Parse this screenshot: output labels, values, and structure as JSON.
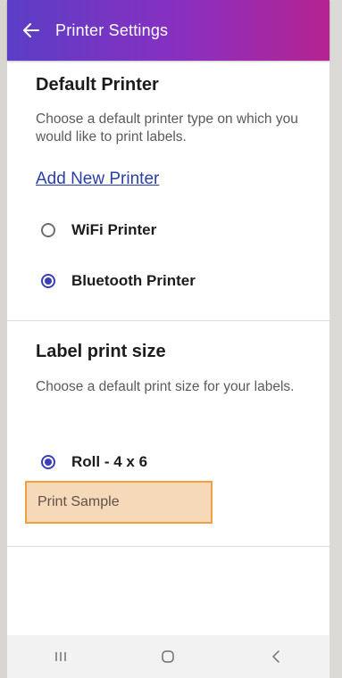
{
  "appbar": {
    "title": "Printer Settings",
    "back_icon": "arrow-left-icon",
    "gradient": [
      "#5b3ec6",
      "#8a2fc0",
      "#b5238f"
    ]
  },
  "default_printer": {
    "title": "Default Printer",
    "description": "Choose a default printer type on which you would like to print labels.",
    "add_link": "Add New Printer",
    "options": [
      {
        "label": "WiFi Printer",
        "selected": false
      },
      {
        "label": "Bluetooth Printer",
        "selected": true
      }
    ]
  },
  "label_size": {
    "title": "Label print size",
    "description": "Choose a default print size for your labels.",
    "options": [
      {
        "label": "Roll - 4 x 6",
        "selected": true
      }
    ],
    "print_sample_label": "Print Sample"
  },
  "navbar": {
    "buttons": [
      "recent-apps-icon",
      "home-icon",
      "back-icon"
    ]
  },
  "colors": {
    "accent": "#3a3fb5",
    "link": "#2b3ea6",
    "highlight_fill": "#f6d9b8",
    "highlight_border": "#f0a041"
  }
}
